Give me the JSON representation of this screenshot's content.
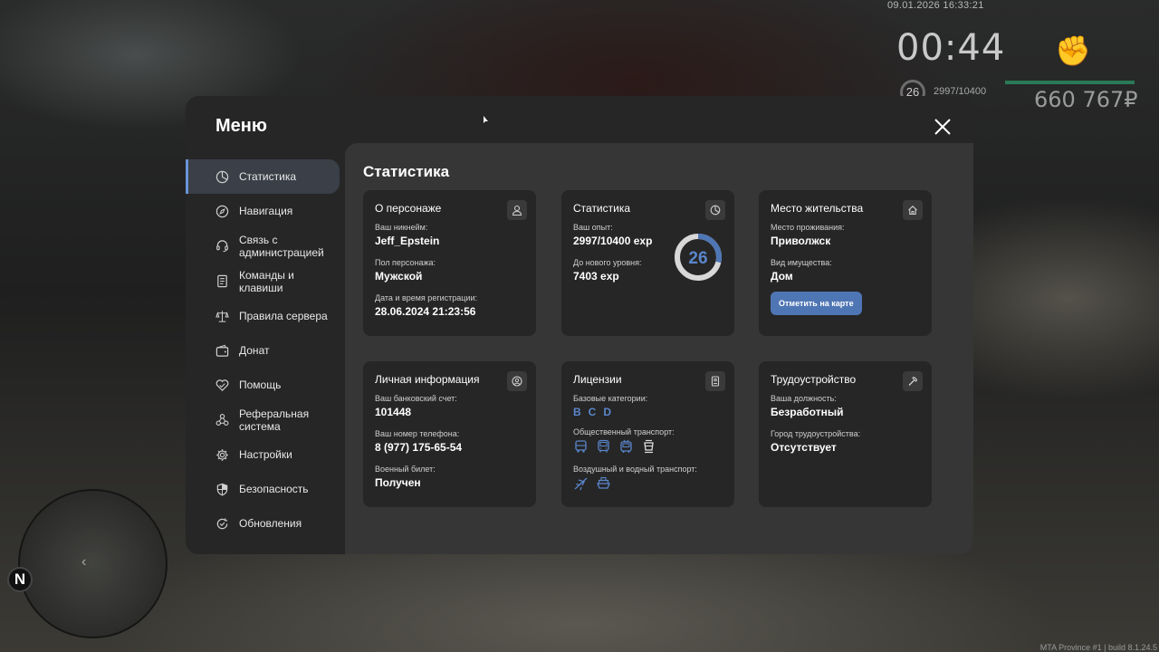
{
  "hud": {
    "datetime": "09.01.2026 16:33:21",
    "timer": "00:44",
    "level": "26",
    "exp": "2997/10400",
    "money": "660 767₽",
    "minimap_north": "N",
    "footer": "MTA Province #1 | build 8.1.24.5"
  },
  "menu": {
    "title": "Меню",
    "nav": [
      {
        "label": "Статистика",
        "icon": "pie-chart-icon"
      },
      {
        "label": "Навигация",
        "icon": "compass-icon"
      },
      {
        "label": "Связь с администрацией",
        "icon": "headset-icon"
      },
      {
        "label": "Команды и клавиши",
        "icon": "document-icon"
      },
      {
        "label": "Правила сервера",
        "icon": "scales-icon"
      },
      {
        "label": "Донат",
        "icon": "wallet-icon"
      },
      {
        "label": "Помощь",
        "icon": "handshake-heart-icon"
      },
      {
        "label": "Реферальная система",
        "icon": "network-icon"
      },
      {
        "label": "Настройки",
        "icon": "gear-icon"
      },
      {
        "label": "Безопасность",
        "icon": "shield-icon"
      },
      {
        "label": "Обновления",
        "icon": "refresh-check-icon"
      }
    ],
    "active": "Статистика"
  },
  "content": {
    "title": "Статистика",
    "character": {
      "title": "О персонаже",
      "nickname_label": "Ваш никнейм:",
      "nickname": "Jeff_Epstein",
      "gender_label": "Пол персонажа:",
      "gender": "Мужской",
      "reg_label": "Дата и время регистрации:",
      "reg": "28.06.2024 21:23:56"
    },
    "stats": {
      "title": "Статистика",
      "exp_label": "Ваш опыт:",
      "exp": "2997/10400 exp",
      "next_label": "До нового уровня:",
      "next": "7403 exp",
      "level": "26",
      "progress": 0.288
    },
    "residence": {
      "title": "Место жительства",
      "place_label": "Место проживания:",
      "place": "Приволжск",
      "property_label": "Вид имущества:",
      "property": "Дом",
      "button": "Отметить на карте"
    },
    "personal": {
      "title": "Личная информация",
      "bank_label": "Ваш банковский счет:",
      "bank": "101448",
      "phone_label": "Ваш номер телефона:",
      "phone": "8 (977) 175-65-54",
      "military_label": "Военный билет:",
      "military": "Получен"
    },
    "licenses": {
      "title": "Лицензии",
      "base_label": "Базовые категории:",
      "categories": [
        "B",
        "C",
        "D"
      ],
      "public_label": "Общественный транспорт:",
      "air_label": "Воздушный и водный транспорт:"
    },
    "employment": {
      "title": "Трудоустройство",
      "position_label": "Ваша должность:",
      "position": "Безработный",
      "city_label": "Город трудоустройства:",
      "city": "Отсутствует"
    }
  }
}
